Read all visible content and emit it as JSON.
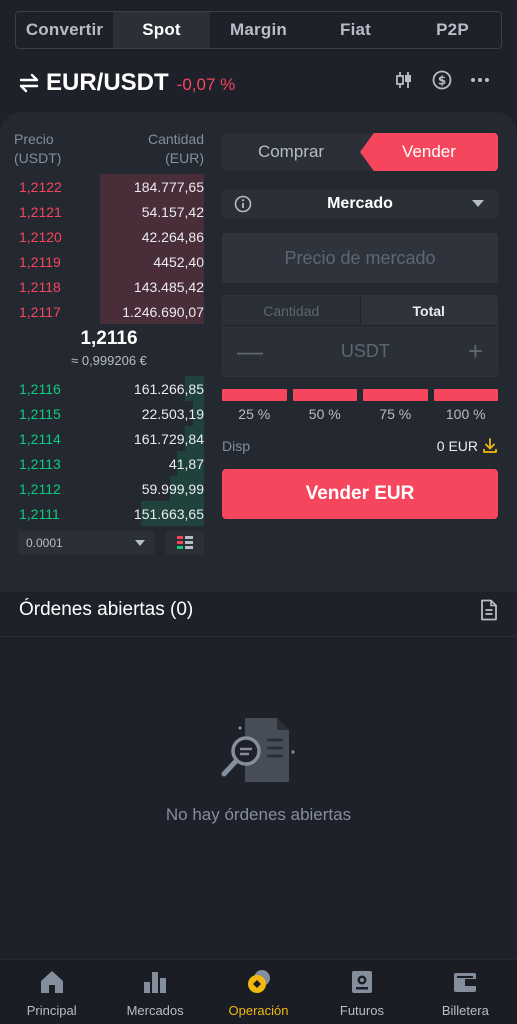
{
  "top_tabs": [
    "Convertir",
    "Spot",
    "Margin",
    "Fiat",
    "P2P"
  ],
  "active_top_tab": "Spot",
  "pair": {
    "name": "EUR/USDT",
    "change": "-0,07 %"
  },
  "order_book": {
    "price_header": "Precio",
    "price_unit": "(USDT)",
    "qty_header": "Cantidad",
    "qty_unit": "(EUR)",
    "asks": [
      {
        "price": "1,2122",
        "qty": "184.777,65",
        "depth": 0.55
      },
      {
        "price": "1,2121",
        "qty": "54.157,42",
        "depth": 0.55
      },
      {
        "price": "1,2120",
        "qty": "42.264,86",
        "depth": 0.55
      },
      {
        "price": "1,2119",
        "qty": "4452,40",
        "depth": 0.55
      },
      {
        "price": "1,2118",
        "qty": "143.485,42",
        "depth": 0.55
      },
      {
        "price": "1,2117",
        "qty": "1.246.690,07",
        "depth": 0.55
      }
    ],
    "mid_price": "1,2116",
    "mid_fiat": "≈ 0,999206 €",
    "bids": [
      {
        "price": "1,2116",
        "qty": "161.266,85",
        "depth": 0.1
      },
      {
        "price": "1,2115",
        "qty": "22.503,19",
        "depth": 0.06
      },
      {
        "price": "1,2114",
        "qty": "161.729,84",
        "depth": 0.1
      },
      {
        "price": "1,2113",
        "qty": "41,87",
        "depth": 0.14
      },
      {
        "price": "1,2112",
        "qty": "59.999,99",
        "depth": 0.18
      },
      {
        "price": "1,2111",
        "qty": "151.663,65",
        "depth": 0.33
      }
    ],
    "step": "0.0001"
  },
  "form": {
    "buy_label": "Comprar",
    "sell_label": "Vender",
    "order_type": "Mercado",
    "market_price_placeholder": "Precio de mercado",
    "qty_tab": "Cantidad",
    "total_tab": "Total",
    "unit": "USDT",
    "minus": "—",
    "plus": "+",
    "percents": [
      "25 %",
      "50 %",
      "75 %",
      "100 %"
    ],
    "avail_label": "Disp",
    "avail_value": "0 EUR",
    "submit_label": "Vender EUR"
  },
  "open_orders": {
    "title": "Órdenes abiertas (0)",
    "empty_text": "No hay órdenes abiertas"
  },
  "bottom_nav": [
    {
      "label": "Principal",
      "icon": "home-icon"
    },
    {
      "label": "Mercados",
      "icon": "markets-icon"
    },
    {
      "label": "Operación",
      "icon": "trade-icon",
      "active": true
    },
    {
      "label": "Futuros",
      "icon": "futures-icon"
    },
    {
      "label": "Billetera",
      "icon": "wallet-icon"
    }
  ],
  "colors": {
    "red": "#f6465d",
    "green": "#0ecb81",
    "yellow": "#f0b90b"
  }
}
